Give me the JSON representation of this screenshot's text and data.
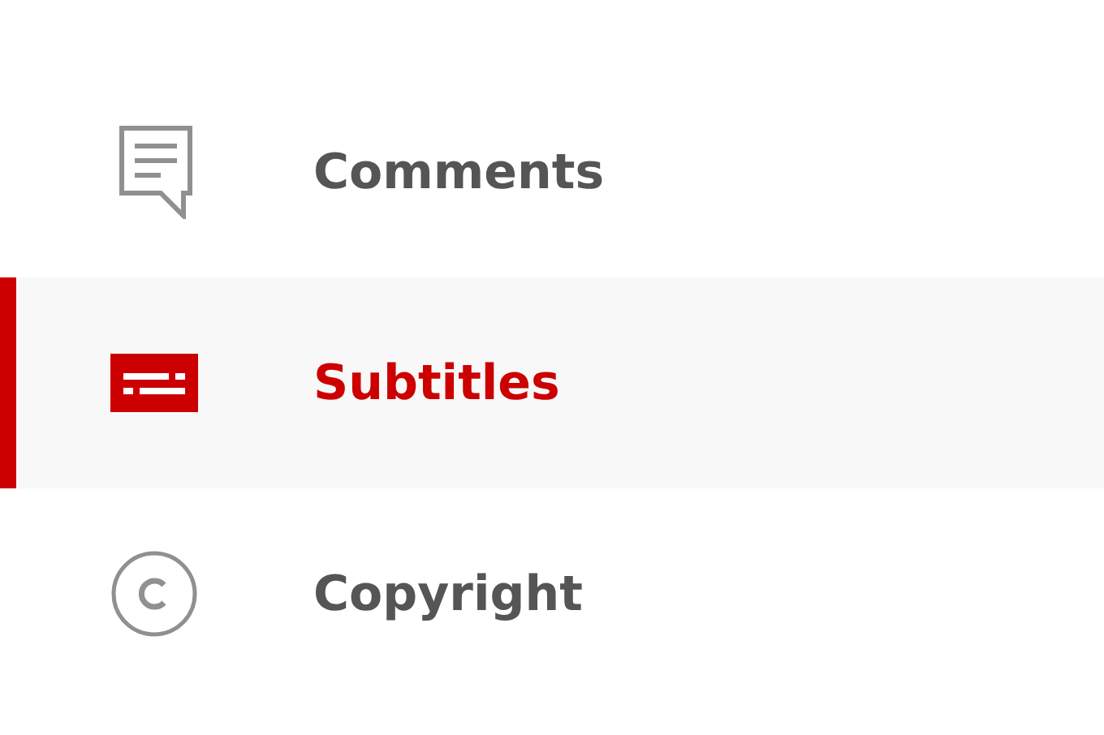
{
  "menu": {
    "items": [
      {
        "label": "Comments",
        "kind": "comments",
        "selected": false
      },
      {
        "label": "Subtitles",
        "kind": "subtitles",
        "selected": true
      },
      {
        "label": "Copyright",
        "kind": "copyright",
        "selected": false
      }
    ]
  }
}
